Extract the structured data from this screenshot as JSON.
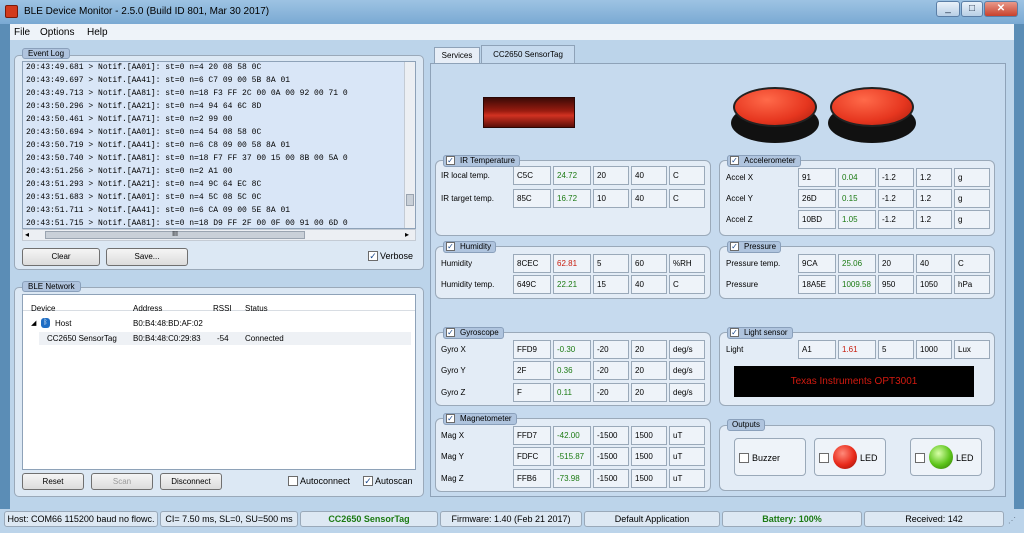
{
  "window": {
    "title": "BLE Device Monitor - 2.5.0 (Build ID 801, Mar 30 2017)"
  },
  "menu": {
    "file": "File",
    "options": "Options",
    "help": "Help"
  },
  "event_log": {
    "label": "Event Log",
    "lines": [
      "20:43:49.681 > Notif.[AA01]: st=0 n=4 20 08 58 0C",
      "20:43:49.697 > Notif.[AA41]: st=0 n=6 C7 09 00 5B 8A 01",
      "20:43:49.713 > Notif.[AA81]: st=0 n=18 F3 FF 2C 00 0A 00 92 00 71 0",
      "20:43:50.296 > Notif.[AA21]: st=0 n=4 94 64 6C 8D",
      "20:43:50.461 > Notif.[AA71]: st=0 n=2 99 00",
      "20:43:50.694 > Notif.[AA01]: st=0 n=4 54 08 58 0C",
      "20:43:50.719 > Notif.[AA41]: st=0 n=6 C8 09 00 58 8A 01",
      "20:43:50.740 > Notif.[AA81]: st=0 n=18 F7 FF 37 00 15 00 8B 00 5A 0",
      "20:43:51.256 > Notif.[AA71]: st=0 n=2 A1 00",
      "20:43:51.293 > Notif.[AA21]: st=0 n=4 9C 64 EC 8C",
      "20:43:51.683 > Notif.[AA01]: st=0 n=4 5C 08 5C 0C",
      "20:43:51.711 > Notif.[AA41]: st=0 n=6 CA 09 00 5E 8A 01",
      "20:43:51.715 > Notif.[AA81]: st=0 n=18 D9 FF 2F 00 0F 00 91 00 6D 0"
    ],
    "scroll_mark": "III",
    "clear": "Clear",
    "save": "Save...",
    "verbose": "Verbose"
  },
  "ble_network": {
    "label": "BLE Network",
    "columns": [
      "Device",
      "Address",
      "RSSI",
      "Status"
    ],
    "rows": [
      {
        "device": "Host",
        "address": "B0:B4:48:BD:AF:02",
        "rssi": "",
        "status": ""
      },
      {
        "device": "CC2650 SensorTag",
        "address": "B0:B4:48:C0:29:83",
        "rssi": "-54",
        "status": "Connected"
      }
    ],
    "reset": "Reset",
    "scan": "Scan",
    "disconnect": "Disconnect",
    "autoconnect": "Autoconnect",
    "autoscan": "Autoscan"
  },
  "tabs": [
    "Services",
    "CC2650 SensorTag"
  ],
  "sensors": {
    "ir": {
      "label": "IR Temperature",
      "rows": [
        {
          "name": "IR local temp.",
          "raw": "C5C",
          "val": "24.72",
          "min": "20",
          "max": "40",
          "unit": "C",
          "color": "g"
        },
        {
          "name": "IR target temp.",
          "raw": "85C",
          "val": "16.72",
          "min": "10",
          "max": "40",
          "unit": "C",
          "color": "g"
        }
      ]
    },
    "acc": {
      "label": "Accelerometer",
      "rows": [
        {
          "name": "Accel X",
          "raw": "91",
          "val": "0.04",
          "min": "-1.2",
          "max": "1.2",
          "unit": "g",
          "color": "g"
        },
        {
          "name": "Accel Y",
          "raw": "26D",
          "val": "0.15",
          "min": "-1.2",
          "max": "1.2",
          "unit": "g",
          "color": "g"
        },
        {
          "name": "Accel Z",
          "raw": "10BD",
          "val": "1.05",
          "min": "-1.2",
          "max": "1.2",
          "unit": "g",
          "color": "g"
        }
      ]
    },
    "hum": {
      "label": "Humidity",
      "rows": [
        {
          "name": "Humidity",
          "raw": "8CEC",
          "val": "62.81",
          "min": "5",
          "max": "60",
          "unit": "%RH",
          "color": "r"
        },
        {
          "name": "Humidity temp.",
          "raw": "649C",
          "val": "22.21",
          "min": "15",
          "max": "40",
          "unit": "C",
          "color": "g"
        }
      ]
    },
    "pres": {
      "label": "Pressure",
      "rows": [
        {
          "name": "Pressure temp.",
          "raw": "9CA",
          "val": "25.06",
          "min": "20",
          "max": "40",
          "unit": "C",
          "color": "g"
        },
        {
          "name": "Pressure",
          "raw": "18A5E",
          "val": "1009.58",
          "min": "950",
          "max": "1050",
          "unit": "hPa",
          "color": "g"
        }
      ]
    },
    "gyro": {
      "label": "Gyroscope",
      "rows": [
        {
          "name": "Gyro X",
          "raw": "FFD9",
          "val": "-0.30",
          "min": "-20",
          "max": "20",
          "unit": "deg/s",
          "color": "g"
        },
        {
          "name": "Gyro Y",
          "raw": "2F",
          "val": "0.36",
          "min": "-20",
          "max": "20",
          "unit": "deg/s",
          "color": "g"
        },
        {
          "name": "Gyro Z",
          "raw": "F",
          "val": "0.11",
          "min": "-20",
          "max": "20",
          "unit": "deg/s",
          "color": "g"
        }
      ]
    },
    "light": {
      "label": "Light sensor",
      "rows": [
        {
          "name": "Light",
          "raw": "A1",
          "val": "1.61",
          "min": "5",
          "max": "1000",
          "unit": "Lux",
          "color": "r"
        }
      ],
      "display": "Texas Instruments OPT3001"
    },
    "mag": {
      "label": "Magnetometer",
      "rows": [
        {
          "name": "Mag X",
          "raw": "FFD7",
          "val": "-42.00",
          "min": "-1500",
          "max": "1500",
          "unit": "uT",
          "color": "g"
        },
        {
          "name": "Mag Y",
          "raw": "FDFC",
          "val": "-515.87",
          "min": "-1500",
          "max": "1500",
          "unit": "uT",
          "color": "g"
        },
        {
          "name": "Mag Z",
          "raw": "FFB6",
          "val": "-73.98",
          "min": "-1500",
          "max": "1500",
          "unit": "uT",
          "color": "g"
        }
      ]
    }
  },
  "outputs": {
    "label": "Outputs",
    "buzzer": "Buzzer",
    "led1": "LED",
    "led2": "LED"
  },
  "status": {
    "host": "Host: COM66 115200 baud no flowc.",
    "ci": "CI= 7.50 ms, SL=0, SU=500 ms",
    "device": "CC2650 SensorTag",
    "firmware": "Firmware: 1.40 (Feb 21 2017)",
    "app": "Default Application",
    "battery": "Battery: 100%",
    "received": "Received: 142"
  },
  "colors": {
    "accent": "#1b7a12",
    "alarm": "#c81c0c",
    "led_red": "#e8291a",
    "led_green": "#5cc41a"
  }
}
